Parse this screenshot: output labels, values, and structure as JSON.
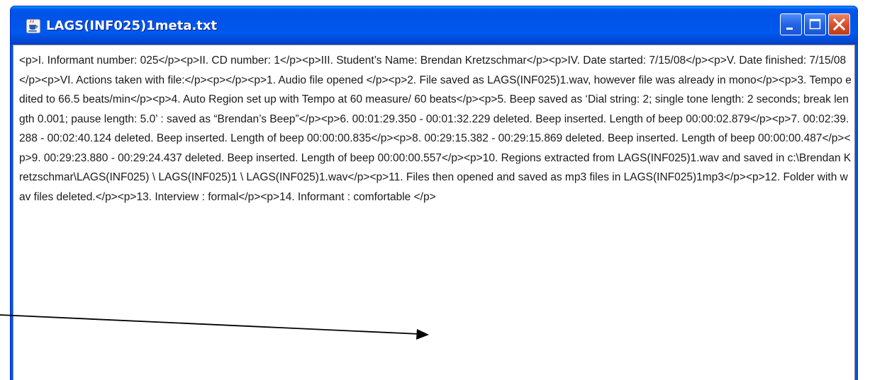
{
  "window": {
    "title": "LAGS(INF025)1meta.txt",
    "icon": "java-cup-icon",
    "controls": {
      "minimize": "minimize-icon",
      "maximize": "maximize-icon",
      "close": "close-icon"
    },
    "colors": {
      "titlebar": "#0054e3",
      "close": "#d9522f",
      "text": "#1a1a1a"
    }
  },
  "document": {
    "text": "<p>I. Informant number:  025</p><p>II. CD number: 1</p><p>III. Student’s Name: Brendan Kretzschmar</p><p>IV. Date started: 7/15/08</p><p>V. Date finished:  7/15/08</p><p>VI. Actions taken with file:</p><p></p><p>1. Audio file opened </p><p>2. File saved as LAGS(INF025)1.wav, however file was already in mono</p><p>3. Tempo edited to 66.5 beats/min</p><p>4. Auto Region set up with Tempo at 60 measure/ 60 beats</p><p>5. Beep saved as ‘Dial string: 2; single tone length: 2 seconds; break length 0.001; pause length: 5.0’ : saved as “Brendan’s Beep”</p><p>6. 00:01:29.350 - 00:01:32.229 deleted.  Beep inserted.  Length of beep 00:00:02.879</p><p>7. 00:02:39.288 - 00:02:40.124 deleted.  Beep inserted.  Length of beep 00:00:00.835</p><p>8. 00:29:15.382 - 00:29:15.869 deleted.  Beep inserted.  Length of beep 00:00:00.487</p><p>9. 00:29:23.880 - 00:29:24.437 deleted.  Beep inserted.  Length of beep 00:00:00.557</p><p>10. Regions extracted from LAGS(INF025)1.wav and saved in c:\\Brendan Kretzschmar\\LAGS(INF025) \\ LAGS(INF025)1 \\ LAGS(INF025)1.wav</p><p>11. Files then opened and saved as mp3 files in LAGS(INF025)1mp3</p><p>12. Folder with wav files deleted.</p><p>13. Interview : formal</p><p>14. Informant : comfortable </p>"
  }
}
